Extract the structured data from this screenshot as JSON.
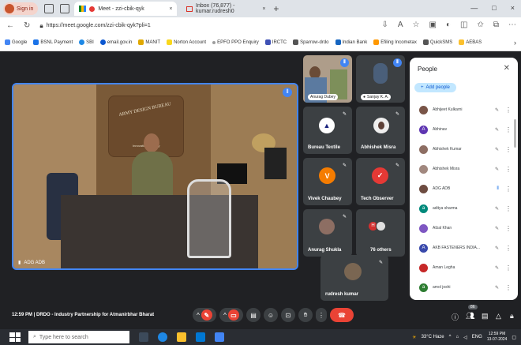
{
  "browser": {
    "signin_label": "Sign in",
    "tabs": [
      {
        "title": "Meet - zzi-cbik-qyk",
        "close": "×"
      },
      {
        "title": "Inbox (76,877) - kumar.rudresh0",
        "close": "×"
      }
    ],
    "new_tab": "+",
    "window_controls": [
      "—",
      "□",
      "×"
    ],
    "url": "https://meet.google.com/zzi-cbik-qyk?pli=1"
  },
  "bookmarks": [
    "Google",
    "BSNL Payment",
    "SBI",
    "email.gov.in",
    "MANIT",
    "Norton Account",
    "EPFO PPO Enquiry",
    "IRCTC",
    "Sparrow-drdo",
    "Indian Bank",
    "Efiling Incometax",
    "QuickSMS",
    "AEBAS"
  ],
  "meet": {
    "main_speaker": "ADG ADB",
    "main_wall_text": "ARMY DESIGN BUREAU",
    "main_wall_sub": "Innovation for Army",
    "tiles": [
      {
        "name": "Anurag Dubey",
        "pill": true
      },
      {
        "name": "Sanjay K. A.",
        "pill": true
      },
      {
        "name": "Bureau Textile"
      },
      {
        "name": "Abhishek Misra"
      },
      {
        "name": "Vivek Chaubey",
        "initial": "V"
      },
      {
        "name": "Tech Observer"
      },
      {
        "name": "Anurag Shukla"
      },
      {
        "name": "76 others",
        "initial": "H"
      },
      {
        "name": "rudresh kumar"
      }
    ],
    "meeting_info": "12:59 PM  |  DRDO - Industry Partnership for Atmanirbhar Bharat",
    "participant_count": "86"
  },
  "people_panel": {
    "title": "People",
    "add_people": "Add people",
    "participants": [
      {
        "name": "Abhijeet Kulkarni",
        "color": "#795548"
      },
      {
        "name": "Abhinav",
        "initial": "A",
        "color": "#5e35b1"
      },
      {
        "name": "Abhishek Kumar",
        "color": "#8d6e63"
      },
      {
        "name": "Abhishek Misra",
        "color": "#a1887f"
      },
      {
        "name": "ADG ADB",
        "color": "#6d4c41"
      },
      {
        "name": "aditya sharma",
        "initial": "a",
        "color": "#00897b"
      },
      {
        "name": "Afzal Khan",
        "color": "#7e57c2"
      },
      {
        "name": "AKB FASTENERS INDIA...",
        "initial": "A",
        "color": "#3949ab"
      },
      {
        "name": "Aman Legha",
        "color": "#c62828"
      },
      {
        "name": "amol joshi",
        "initial": "a",
        "color": "#2e7d32"
      }
    ]
  },
  "taskbar": {
    "search_placeholder": "Type here to search",
    "weather": "33°C Haze",
    "lang": "ENG",
    "time": "12:59 PM",
    "date": "13-07-2024"
  }
}
